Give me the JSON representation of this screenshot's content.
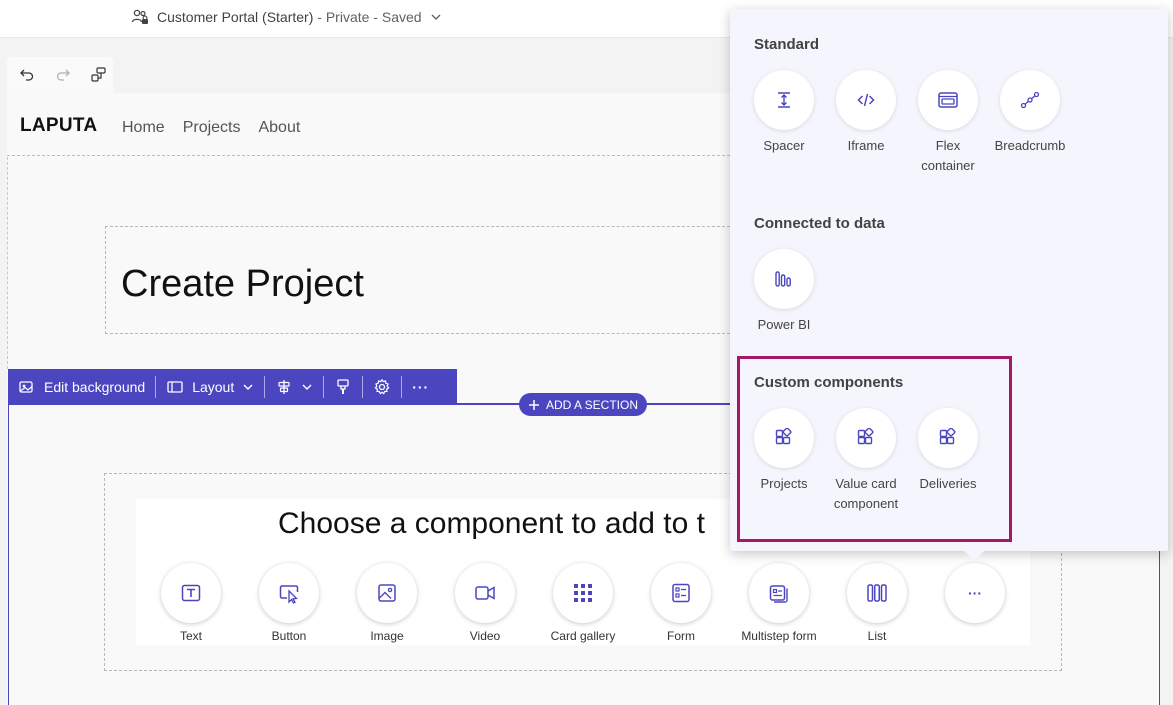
{
  "header": {
    "site_name": "Customer Portal (Starter)",
    "separator1": " - ",
    "visibility": "Private",
    "separator2": " - ",
    "save_state": "Saved"
  },
  "site": {
    "logo": "LAPUTA",
    "nav": [
      "Home",
      "Projects",
      "About"
    ]
  },
  "page": {
    "heading": "Create Project"
  },
  "section_toolbar": {
    "edit_background": "Edit background",
    "layout": "Layout",
    "more": "···"
  },
  "add_section": "ADD A SECTION",
  "components": {
    "prompt": "Choose a component to add to t",
    "items": [
      "Text",
      "Button",
      "Image",
      "Video",
      "Card gallery",
      "Form",
      "Multistep form",
      "List"
    ],
    "more": "···"
  },
  "flyout": {
    "standard": {
      "title": "Standard",
      "items": [
        {
          "line1": "Spacer",
          "line2": ""
        },
        {
          "line1": "Iframe",
          "line2": ""
        },
        {
          "line1": "Flex",
          "line2": "container"
        },
        {
          "line1": "Breadcrumb",
          "line2": ""
        }
      ]
    },
    "connected": {
      "title": "Connected to data",
      "items": [
        {
          "line1": "Power BI",
          "line2": ""
        }
      ]
    },
    "custom": {
      "title": "Custom components",
      "items": [
        {
          "line1": "Projects",
          "line2": ""
        },
        {
          "line1": "Value card",
          "line2": "component"
        },
        {
          "line1": "Deliveries",
          "line2": ""
        }
      ]
    }
  },
  "colors": {
    "accent": "#4b46c0",
    "highlight": "#a6176a",
    "flyout_bg": "#f5f5fd"
  }
}
